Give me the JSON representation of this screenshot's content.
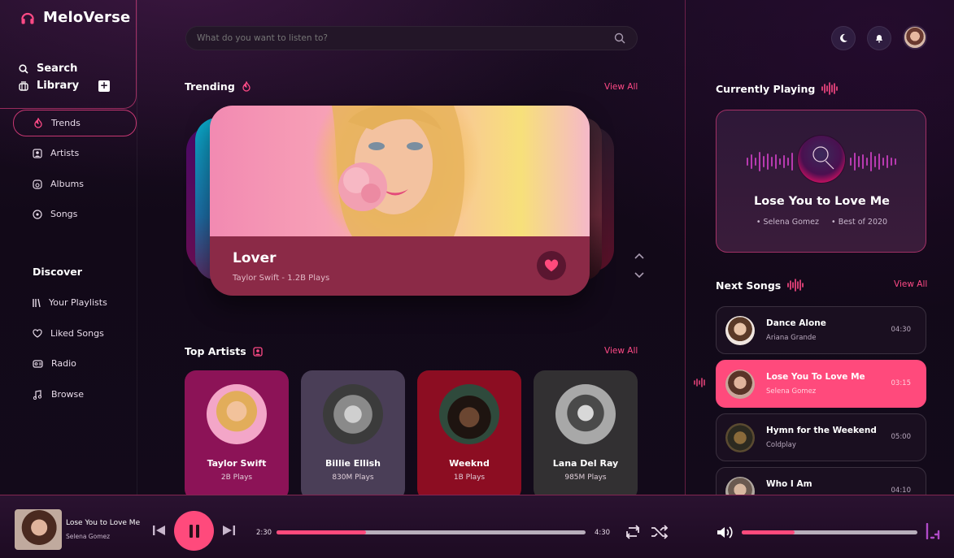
{
  "brand": {
    "name": "MeloVerse"
  },
  "nav": {
    "search": "Search",
    "library": "Library",
    "items": [
      {
        "label": "Trends",
        "icon": "flame-icon",
        "active": true
      },
      {
        "label": "Artists",
        "icon": "artist-icon"
      },
      {
        "label": "Albums",
        "icon": "album-icon"
      },
      {
        "label": "Songs",
        "icon": "song-icon"
      }
    ],
    "discover_title": "Discover",
    "discover": [
      {
        "label": "Your Playlists",
        "icon": "playlist-icon"
      },
      {
        "label": "Liked Songs",
        "icon": "heart-outline-icon"
      },
      {
        "label": "Radio",
        "icon": "radio-icon"
      },
      {
        "label": "Browse",
        "icon": "music-note-icon"
      }
    ]
  },
  "search": {
    "placeholder": "What do you want to listen to?"
  },
  "trending": {
    "title": "Trending",
    "view_all": "View All",
    "featured": {
      "title": "Lover",
      "subtitle": "Taylor Swift - 1.2B Plays",
      "liked": true
    }
  },
  "top_artists": {
    "title": "Top Artists",
    "view_all": "View All",
    "artists": [
      {
        "name": "Taylor Swift",
        "plays": "2B Plays",
        "bg": "#8c1357"
      },
      {
        "name": "Billie Ellish",
        "plays": "830M Plays",
        "bg": "#4a3e57"
      },
      {
        "name": "Weeknd",
        "plays": "1B Plays",
        "bg": "#8c0d22"
      },
      {
        "name": "Lana Del Ray",
        "plays": "985M Plays",
        "bg": "#323032"
      }
    ]
  },
  "now_playing": {
    "title": "Currently Playing",
    "song": "Lose You to Love Me",
    "artist": "Selena Gomez",
    "album": "Best of 2020"
  },
  "next_songs": {
    "title": "Next Songs",
    "view_all": "View All",
    "songs": [
      {
        "title": "Dance Alone",
        "artist": "Ariana Grande",
        "duration": "04:30",
        "active": false
      },
      {
        "title": "Lose You To Love Me",
        "artist": "Selena Gomez",
        "duration": "03:15",
        "active": true
      },
      {
        "title": "Hymn for the Weekend",
        "artist": "Coldplay",
        "duration": "05:00",
        "active": false
      },
      {
        "title": "Who I Am",
        "artist": "",
        "duration": "04:10",
        "active": false
      }
    ]
  },
  "player": {
    "song": "Lose You to Love Me",
    "artist": "Selena Gomez",
    "elapsed": "2:30",
    "total": "4:30",
    "progress": 0.29,
    "volume": 0.3
  },
  "colors": {
    "accent": "#ff4a7c",
    "background": "#140a1a"
  }
}
